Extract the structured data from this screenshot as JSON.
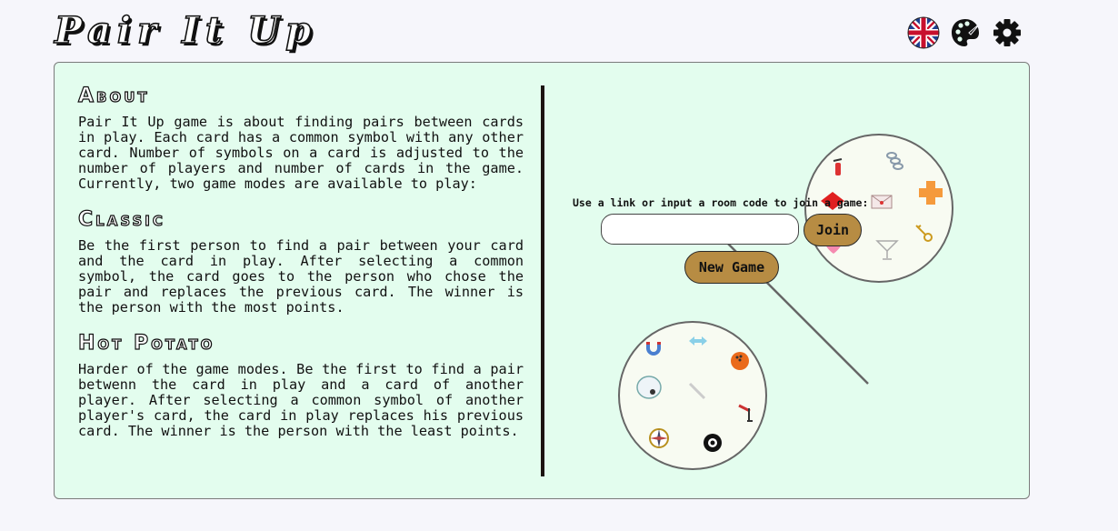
{
  "header": {
    "logo_text": "Pair It Up",
    "icons": [
      "uk-flag-icon",
      "palette-icon",
      "gear-icon"
    ]
  },
  "about": {
    "title": "About",
    "intro": "Pair It Up game is about finding pairs between cards in play. Each card has a common symbol with any other card. Number of symbols on a card is adjusted to the number of players and number of cards in the game. Currently, two game modes are available to play:",
    "classic_title": "Classic",
    "classic_text": "Be the first person to find a pair between your card and the card in play. After selecting a common symbol, the card goes to the person who chose the pair and replaces the previous card. The winner is the person with the most points.",
    "hot_potato_title": "Hot Potato",
    "hot_potato_text": "Harder of the game modes. Be the first to find a pair betwenn the card in play and a card of another player. After selecting a common symbol of another player's card, the card in play replaces his previous card. The winner is the person with the least points."
  },
  "join": {
    "label": "Use a link or input a room code to join a game:",
    "input_value": "",
    "button_label": "Join"
  },
  "new_game": {
    "button_label": "New Game"
  },
  "colors": {
    "panel_bg": "#e3fdee",
    "button_bg": "#b78c43",
    "divider": "#1c1411"
  },
  "cards": {
    "top": [
      "fire-extinguisher-icon",
      "chain-icon",
      "red-diamond-icon",
      "envelope-icon",
      "orange-cross-icon",
      "pink-heart-icon",
      "cocktail-glass-icon",
      "key-icon"
    ],
    "bottom": [
      "magnet-icon",
      "arrows-icon",
      "bowling-ball-icon",
      "egg-icon",
      "bandage-icon",
      "compass-icon",
      "eight-ball-icon",
      "arrow-target-icon"
    ]
  }
}
